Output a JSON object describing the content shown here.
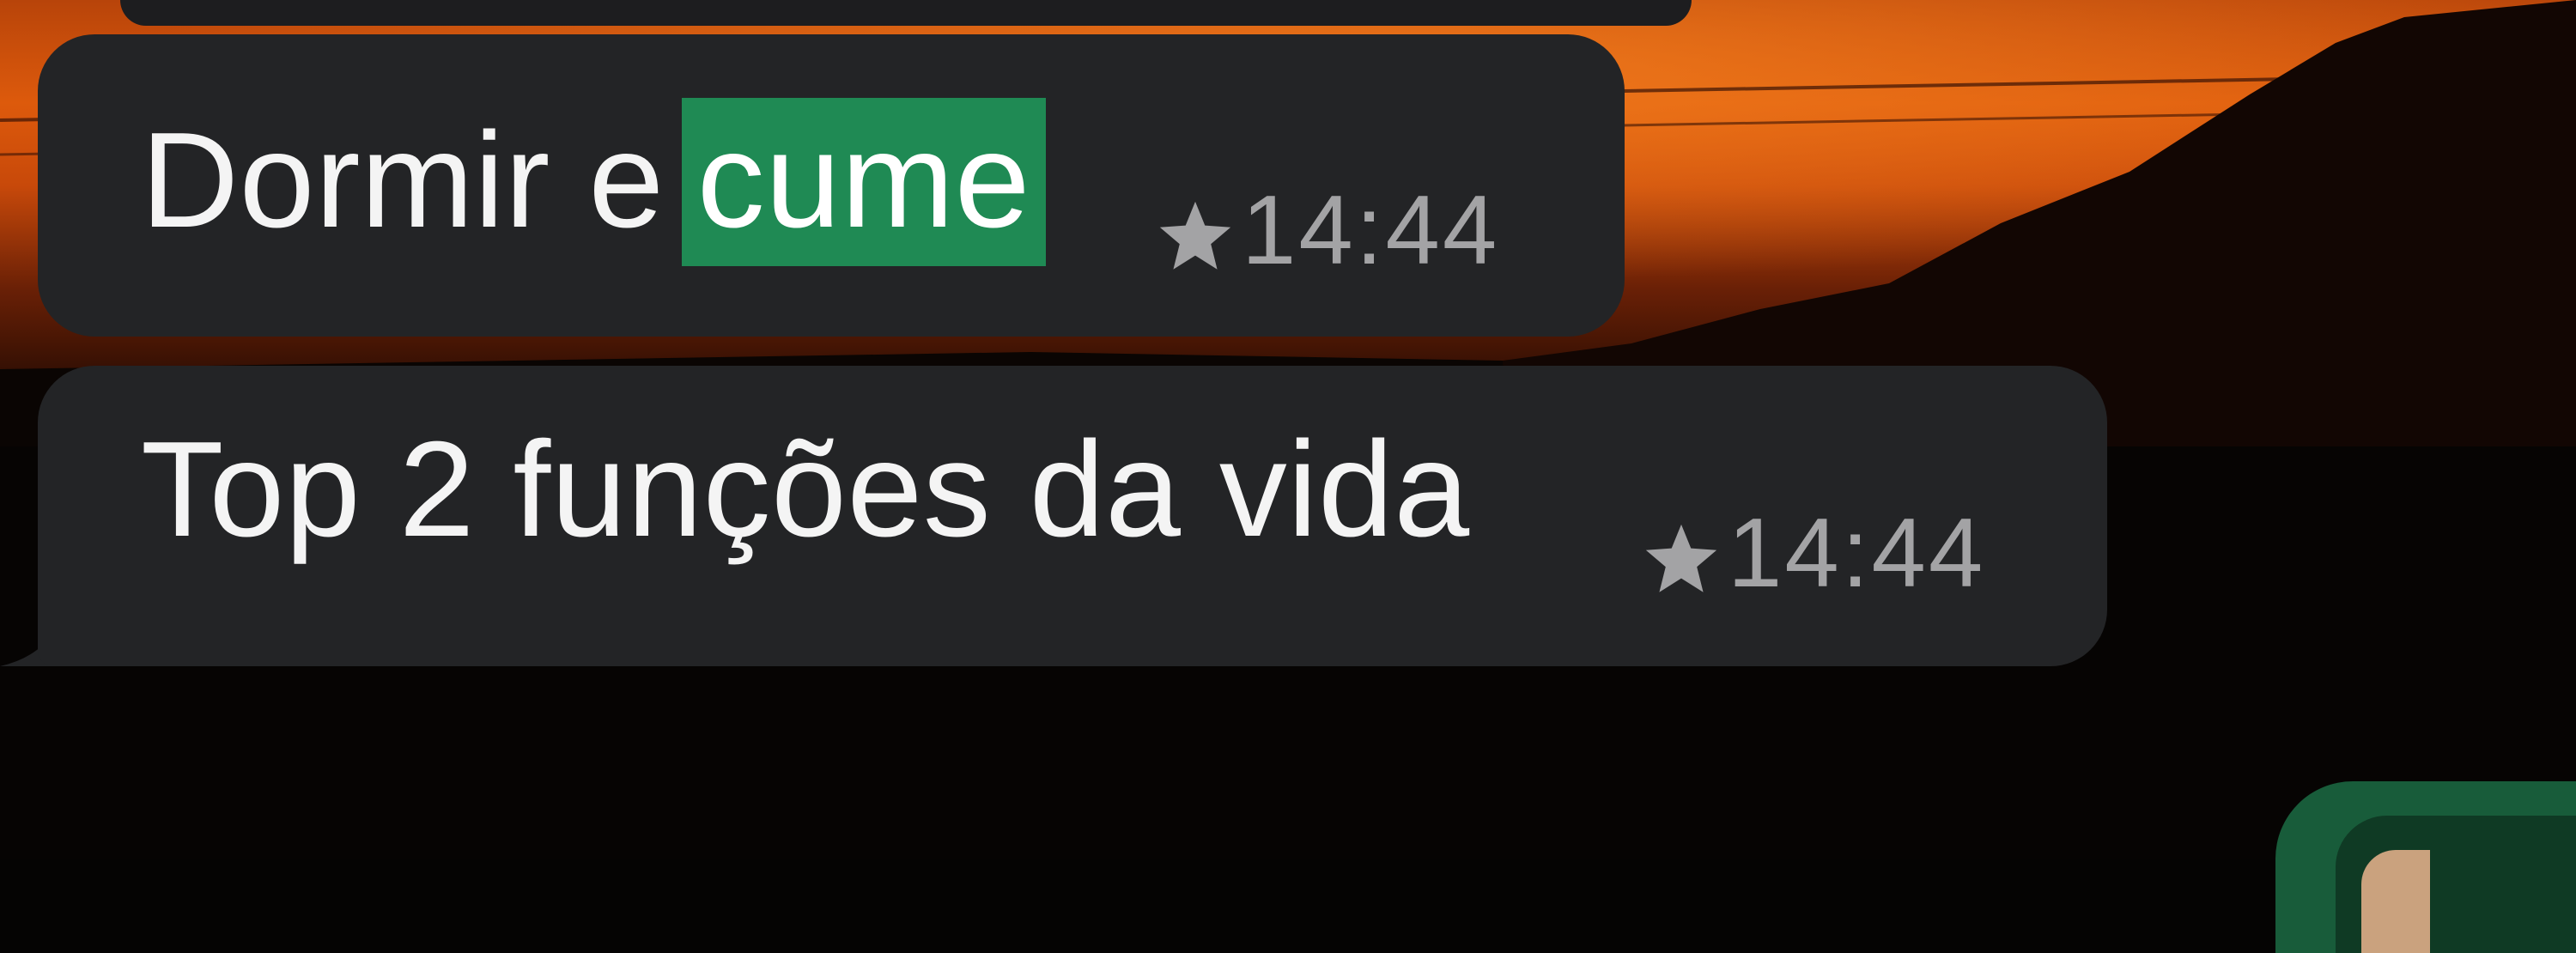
{
  "messages": [
    {
      "text_before": "Dormir e",
      "highlighted": "cume",
      "starred": true,
      "time": "14:44"
    },
    {
      "text": "Top 2 funções da vida",
      "starred": true,
      "time": "14:44"
    }
  ],
  "colors": {
    "bubble_incoming": "#232426",
    "search_highlight": "#1f8a54",
    "meta_text": "#a3a3a5",
    "wallpaper_sky": "#d9540a"
  },
  "icons": {
    "starred": "star-icon"
  }
}
